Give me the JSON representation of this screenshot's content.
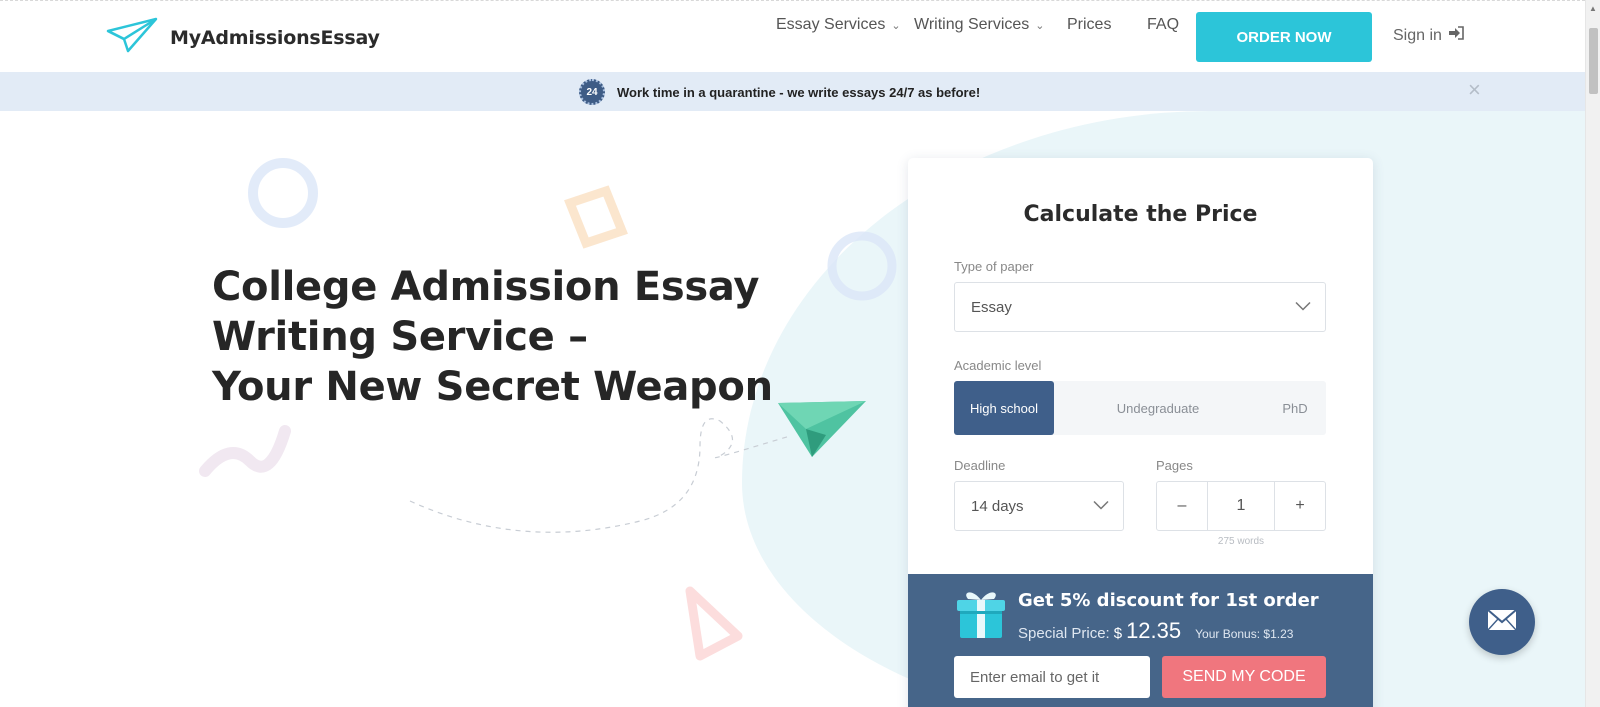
{
  "header": {
    "logo_text": "MyAdmissionsEssay",
    "nav": [
      {
        "label": "Essay Services",
        "dropdown": true
      },
      {
        "label": "Writing Services",
        "dropdown": true
      },
      {
        "label": "Prices",
        "dropdown": false
      },
      {
        "label": "FAQ",
        "dropdown": false
      }
    ],
    "order_button": "ORDER NOW",
    "sign_in": "Sign in"
  },
  "banner": {
    "badge": "24",
    "text": "Work time in a quarantine - we write essays 24/7 as before!"
  },
  "hero": {
    "title_lines": [
      "College Admission Essay",
      "Writing Service –",
      "Your New Secret Weapon"
    ]
  },
  "calculator": {
    "title": "Calculate the Price",
    "type_label": "Type of paper",
    "type_value": "Essay",
    "level_label": "Academic level",
    "levels": [
      "High school",
      "Undegraduate",
      "PhD"
    ],
    "level_selected": "High school",
    "deadline_label": "Deadline",
    "deadline_value": "14 days",
    "pages_label": "Pages",
    "pages_minus": "–",
    "pages_value": "1",
    "pages_plus": "+",
    "words": "275 words"
  },
  "promo": {
    "title": "Get 5% discount for 1st order",
    "special_label": "Special Price:",
    "currency": "$",
    "special_price": "12.35",
    "bonus": "Your Bonus: $1.23",
    "email_placeholder": "Enter email to get it",
    "send_button": "SEND MY CODE"
  },
  "colors": {
    "accent_teal": "#2cc5d9",
    "navy": "#3f5f8a",
    "promo_bg": "#466589",
    "send_red": "#f0767e",
    "banner_bg": "#e2ebf6"
  },
  "icons": [
    "paper-plane-icon",
    "chevron-down-icon",
    "sign-in-icon",
    "close-icon",
    "gift-icon",
    "mail-icon"
  ]
}
